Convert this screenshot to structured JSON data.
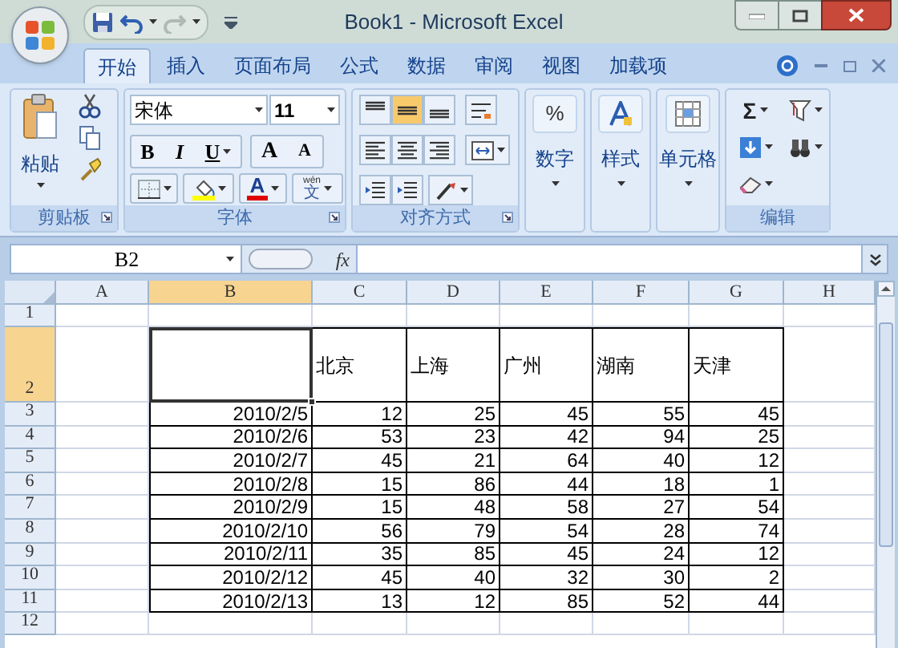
{
  "title_bar": {
    "title": "Book1 - Microsoft Excel"
  },
  "tabs": [
    {
      "label": "开始",
      "selected": true
    },
    {
      "label": "插入",
      "selected": false
    },
    {
      "label": "页面布局",
      "selected": false
    },
    {
      "label": "公式",
      "selected": false
    },
    {
      "label": "数据",
      "selected": false
    },
    {
      "label": "审阅",
      "selected": false
    },
    {
      "label": "视图",
      "selected": false
    },
    {
      "label": "加载项",
      "selected": false
    }
  ],
  "ribbon": {
    "clipboard": {
      "label": "剪贴板",
      "paste": "粘贴"
    },
    "font": {
      "label": "字体",
      "font_name": "宋体",
      "font_size": "11",
      "bold": "B",
      "italic": "I",
      "underline": "U",
      "grow": "A",
      "shrink": "A",
      "font_color": "A",
      "phonetic_reading": "wén",
      "phonetic_char": "文"
    },
    "alignment": {
      "label": "对齐方式",
      "buttons": [
        {
          "kind": "top",
          "selected": false
        },
        {
          "kind": "middle",
          "selected": true
        },
        {
          "kind": "bottom",
          "selected": false
        },
        {
          "kind": "left",
          "selected": false
        },
        {
          "kind": "center",
          "selected": false
        },
        {
          "kind": "right",
          "selected": false
        }
      ]
    },
    "number": {
      "label": "数字",
      "symbol": "%"
    },
    "styles": {
      "label": "样式"
    },
    "cells": {
      "label": "单元格"
    },
    "editing": {
      "label": "编辑",
      "sum": "Σ"
    }
  },
  "formula_bar": {
    "name_box": "B2",
    "fx": "fx"
  },
  "sheet": {
    "columns": [
      {
        "letter": "A",
        "selected": false
      },
      {
        "letter": "B",
        "selected": true
      },
      {
        "letter": "C",
        "selected": false
      },
      {
        "letter": "D",
        "selected": false
      },
      {
        "letter": "E",
        "selected": false
      },
      {
        "letter": "F",
        "selected": false
      },
      {
        "letter": "G",
        "selected": false
      },
      {
        "letter": "H",
        "selected": false
      }
    ],
    "rows": [
      {
        "header": "1",
        "kind": "blank",
        "selected": false,
        "cells": {}
      },
      {
        "header": "2",
        "kind": "heading",
        "selected": true,
        "cells": {
          "C": "北京",
          "D": "上海",
          "E": "广州",
          "F": "湖南",
          "G": "天津"
        }
      },
      {
        "header": "3",
        "kind": "data",
        "selected": false,
        "cells": {
          "B": "2010/2/5",
          "C": "12",
          "D": "25",
          "E": "45",
          "F": "55",
          "G": "45"
        }
      },
      {
        "header": "4",
        "kind": "data",
        "selected": false,
        "cells": {
          "B": "2010/2/6",
          "C": "53",
          "D": "23",
          "E": "42",
          "F": "94",
          "G": "25"
        }
      },
      {
        "header": "5",
        "kind": "data",
        "selected": false,
        "cells": {
          "B": "2010/2/7",
          "C": "45",
          "D": "21",
          "E": "64",
          "F": "40",
          "G": "12"
        }
      },
      {
        "header": "6",
        "kind": "data",
        "selected": false,
        "cells": {
          "B": "2010/2/8",
          "C": "15",
          "D": "86",
          "E": "44",
          "F": "18",
          "G": "1"
        }
      },
      {
        "header": "7",
        "kind": "data",
        "selected": false,
        "cells": {
          "B": "2010/2/9",
          "C": "15",
          "D": "48",
          "E": "58",
          "F": "27",
          "G": "54"
        }
      },
      {
        "header": "8",
        "kind": "data",
        "selected": false,
        "cells": {
          "B": "2010/2/10",
          "C": "56",
          "D": "79",
          "E": "54",
          "F": "28",
          "G": "74"
        }
      },
      {
        "header": "9",
        "kind": "data",
        "selected": false,
        "cells": {
          "B": "2010/2/11",
          "C": "35",
          "D": "85",
          "E": "45",
          "F": "24",
          "G": "12"
        }
      },
      {
        "header": "10",
        "kind": "data",
        "selected": false,
        "cells": {
          "B": "2010/2/12",
          "C": "45",
          "D": "40",
          "E": "32",
          "F": "30",
          "G": "2"
        }
      },
      {
        "header": "11",
        "kind": "data",
        "selected": false,
        "cells": {
          "B": "2010/2/13",
          "C": "13",
          "D": "12",
          "E": "85",
          "F": "52",
          "G": "44"
        }
      },
      {
        "header": "12",
        "kind": "blank",
        "selected": false,
        "cells": {}
      }
    ]
  }
}
